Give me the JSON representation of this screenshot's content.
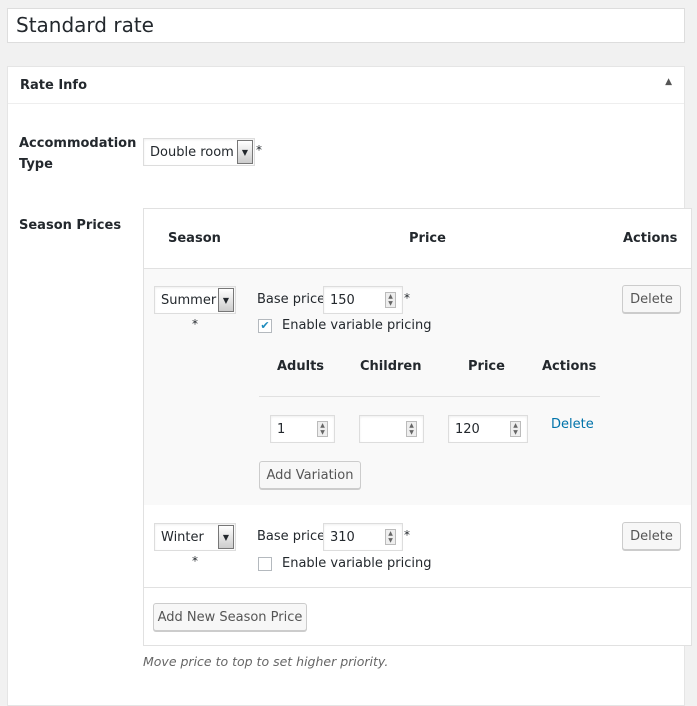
{
  "title": "Standard rate",
  "panel": {
    "heading": "Rate Info",
    "toggle_icon": "triangle-up-icon"
  },
  "accommodation": {
    "label": "Accommodation Type",
    "value": "Double room",
    "required": "*"
  },
  "season_prices": {
    "label": "Season Prices",
    "headers": {
      "season": "Season",
      "price": "Price",
      "actions": "Actions"
    },
    "rows": [
      {
        "season": "Summer",
        "base_price_label": "Base price",
        "base_price": "150",
        "required": "*",
        "variable_label": "Enable variable pricing",
        "variable_checked": true,
        "delete": "Delete",
        "variations": {
          "headers": {
            "adults": "Adults",
            "children": "Children",
            "price": "Price",
            "actions": "Actions"
          },
          "rows": [
            {
              "adults": "1",
              "children": "",
              "price": "120",
              "delete": "Delete"
            }
          ],
          "add_label": "Add Variation"
        }
      },
      {
        "season": "Winter",
        "base_price_label": "Base price",
        "base_price": "310",
        "required": "*",
        "variable_label": "Enable variable pricing",
        "variable_checked": false,
        "delete": "Delete"
      }
    ],
    "add_label": "Add New Season Price",
    "hint": "Move price to top to set higher priority."
  }
}
